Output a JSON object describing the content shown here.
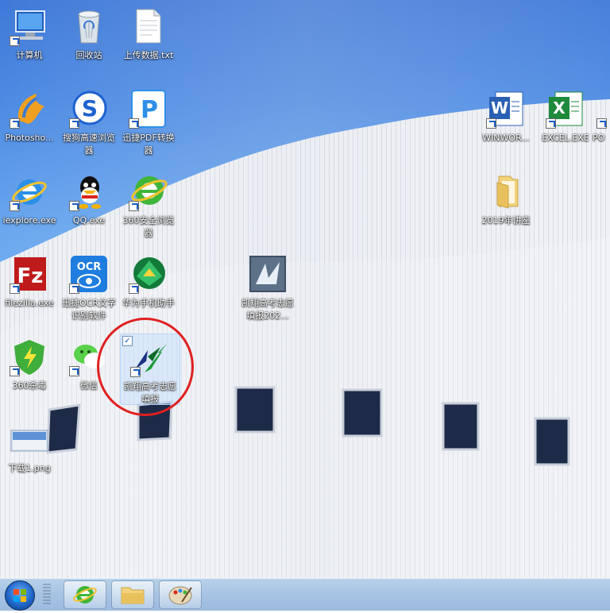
{
  "desktop": {
    "icons": [
      {
        "label": "计算机",
        "icon": "computer-icon"
      },
      {
        "label": "回收站",
        "icon": "recycle-bin-icon"
      },
      {
        "label": "上传数据.txt",
        "icon": "text-file-icon"
      },
      {
        "label": "Photosho...",
        "icon": "photoshop-icon"
      },
      {
        "label": "搜狗高速浏览器",
        "icon": "sogou-browser-icon"
      },
      {
        "label": "迅捷PDF转换器",
        "icon": "pdf-converter-icon"
      },
      {
        "label": "WINWOR...",
        "icon": "word-icon"
      },
      {
        "label": "EXCEL.EXE",
        "icon": "excel-icon"
      },
      {
        "label": "PO",
        "icon": "powerpoint-icon"
      },
      {
        "label": "iexplore.exe",
        "icon": "ie-icon"
      },
      {
        "label": "QQ.exe",
        "icon": "qq-icon"
      },
      {
        "label": "360安全浏览器",
        "icon": "360-browser-icon"
      },
      {
        "label": "2019年讲座",
        "icon": "folder-icon"
      },
      {
        "label": "filezilla.exe",
        "icon": "filezilla-icon"
      },
      {
        "label": "迅捷OCR文字识别软件",
        "icon": "ocr-icon"
      },
      {
        "label": "华为手机助手",
        "icon": "huawei-assistant-icon"
      },
      {
        "label": "凯翔高考志愿填报202...",
        "icon": "app-icon"
      },
      {
        "label": "360杀毒",
        "icon": "360-antivirus-icon"
      },
      {
        "label": "微信",
        "icon": "wechat-icon"
      },
      {
        "label": "凯翔高考志愿填报",
        "icon": "kaixiang-icon"
      },
      {
        "label": "下载1.png",
        "icon": "image-file-icon"
      }
    ],
    "selected_index": 19
  },
  "taskbar": {
    "items": [
      {
        "name": "start",
        "icon": "windows-start-icon"
      },
      {
        "name": "ie",
        "icon": "ie-icon"
      },
      {
        "name": "explorer",
        "icon": "folder-icon"
      },
      {
        "name": "paint",
        "icon": "paint-icon"
      }
    ]
  },
  "colors": {
    "sky": "#4d8be3",
    "highlight_circle": "#e02020"
  }
}
